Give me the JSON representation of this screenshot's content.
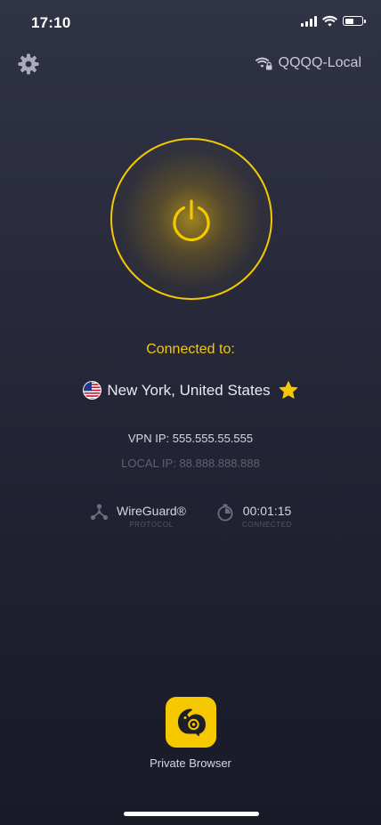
{
  "status_bar": {
    "time": "17:10"
  },
  "header": {
    "settings_icon": "gear-icon",
    "network_icon": "wifi-lock-icon",
    "network_name": "QQQQ-Local"
  },
  "connection": {
    "power_icon": "power-icon",
    "connected_label": "Connected to:",
    "flag_icon": "us-flag-icon",
    "location": "New York, United States",
    "favorite_icon": "star-icon",
    "vpn_ip": "VPN IP: 555.555.55.555",
    "local_ip": "LOCAL IP: 88.888.888.888"
  },
  "stats": {
    "protocol": {
      "icon": "protocol-icon",
      "value": "WireGuard®",
      "caption": "PROTOCOL"
    },
    "duration": {
      "icon": "timer-icon",
      "value": "00:01:15",
      "caption": "CONNECTED"
    }
  },
  "private_browser": {
    "icon": "chameleon-icon",
    "label": "Private Browser"
  },
  "colors": {
    "accent": "#f5c800",
    "background_top": "#303346",
    "background_bottom": "#191a28",
    "muted_text": "#5f6172"
  }
}
